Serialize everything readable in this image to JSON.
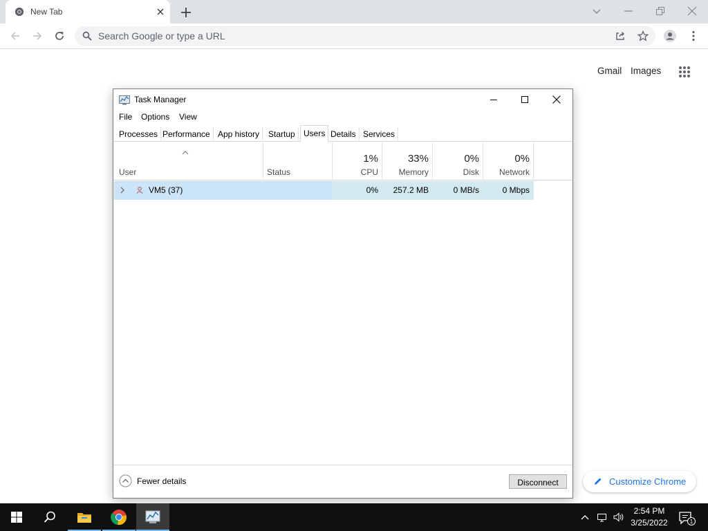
{
  "browser": {
    "tab": {
      "title": "New Tab"
    },
    "omnibox": {
      "placeholder": "Search Google or type a URL"
    },
    "ntp": {
      "links": [
        "Gmail",
        "Images"
      ],
      "customize_label": "Customize Chrome",
      "accent_color": "#1a73e8"
    }
  },
  "task_manager": {
    "title": "Task Manager",
    "menu": [
      "File",
      "Options",
      "View"
    ],
    "tabs": [
      "Processes",
      "Performance",
      "App history",
      "Startup",
      "Users",
      "Details",
      "Services"
    ],
    "active_tab": "Users",
    "columns": {
      "user": "User",
      "status": "Status",
      "cpu": {
        "percent": "1%",
        "label": "CPU"
      },
      "memory": {
        "percent": "33%",
        "label": "Memory"
      },
      "disk": {
        "percent": "0%",
        "label": "Disk"
      },
      "network": {
        "percent": "0%",
        "label": "Network"
      }
    },
    "rows": [
      {
        "user": "VM5 (37)",
        "status": "",
        "cpu": "0%",
        "memory": "257.2 MB",
        "disk": "0 MB/s",
        "network": "0 Mbps"
      }
    ],
    "footer": {
      "fewer_details": "Fewer details",
      "disconnect": "Disconnect"
    },
    "selection_color": "#cce4f7"
  },
  "taskbar": {
    "apps": [
      "start-icon",
      "search-icon",
      "file-explorer-icon",
      "chrome-icon",
      "task-manager-icon"
    ],
    "clock": {
      "time": "2:54 PM",
      "date": "3/25/2022"
    },
    "notification_count": "1"
  }
}
